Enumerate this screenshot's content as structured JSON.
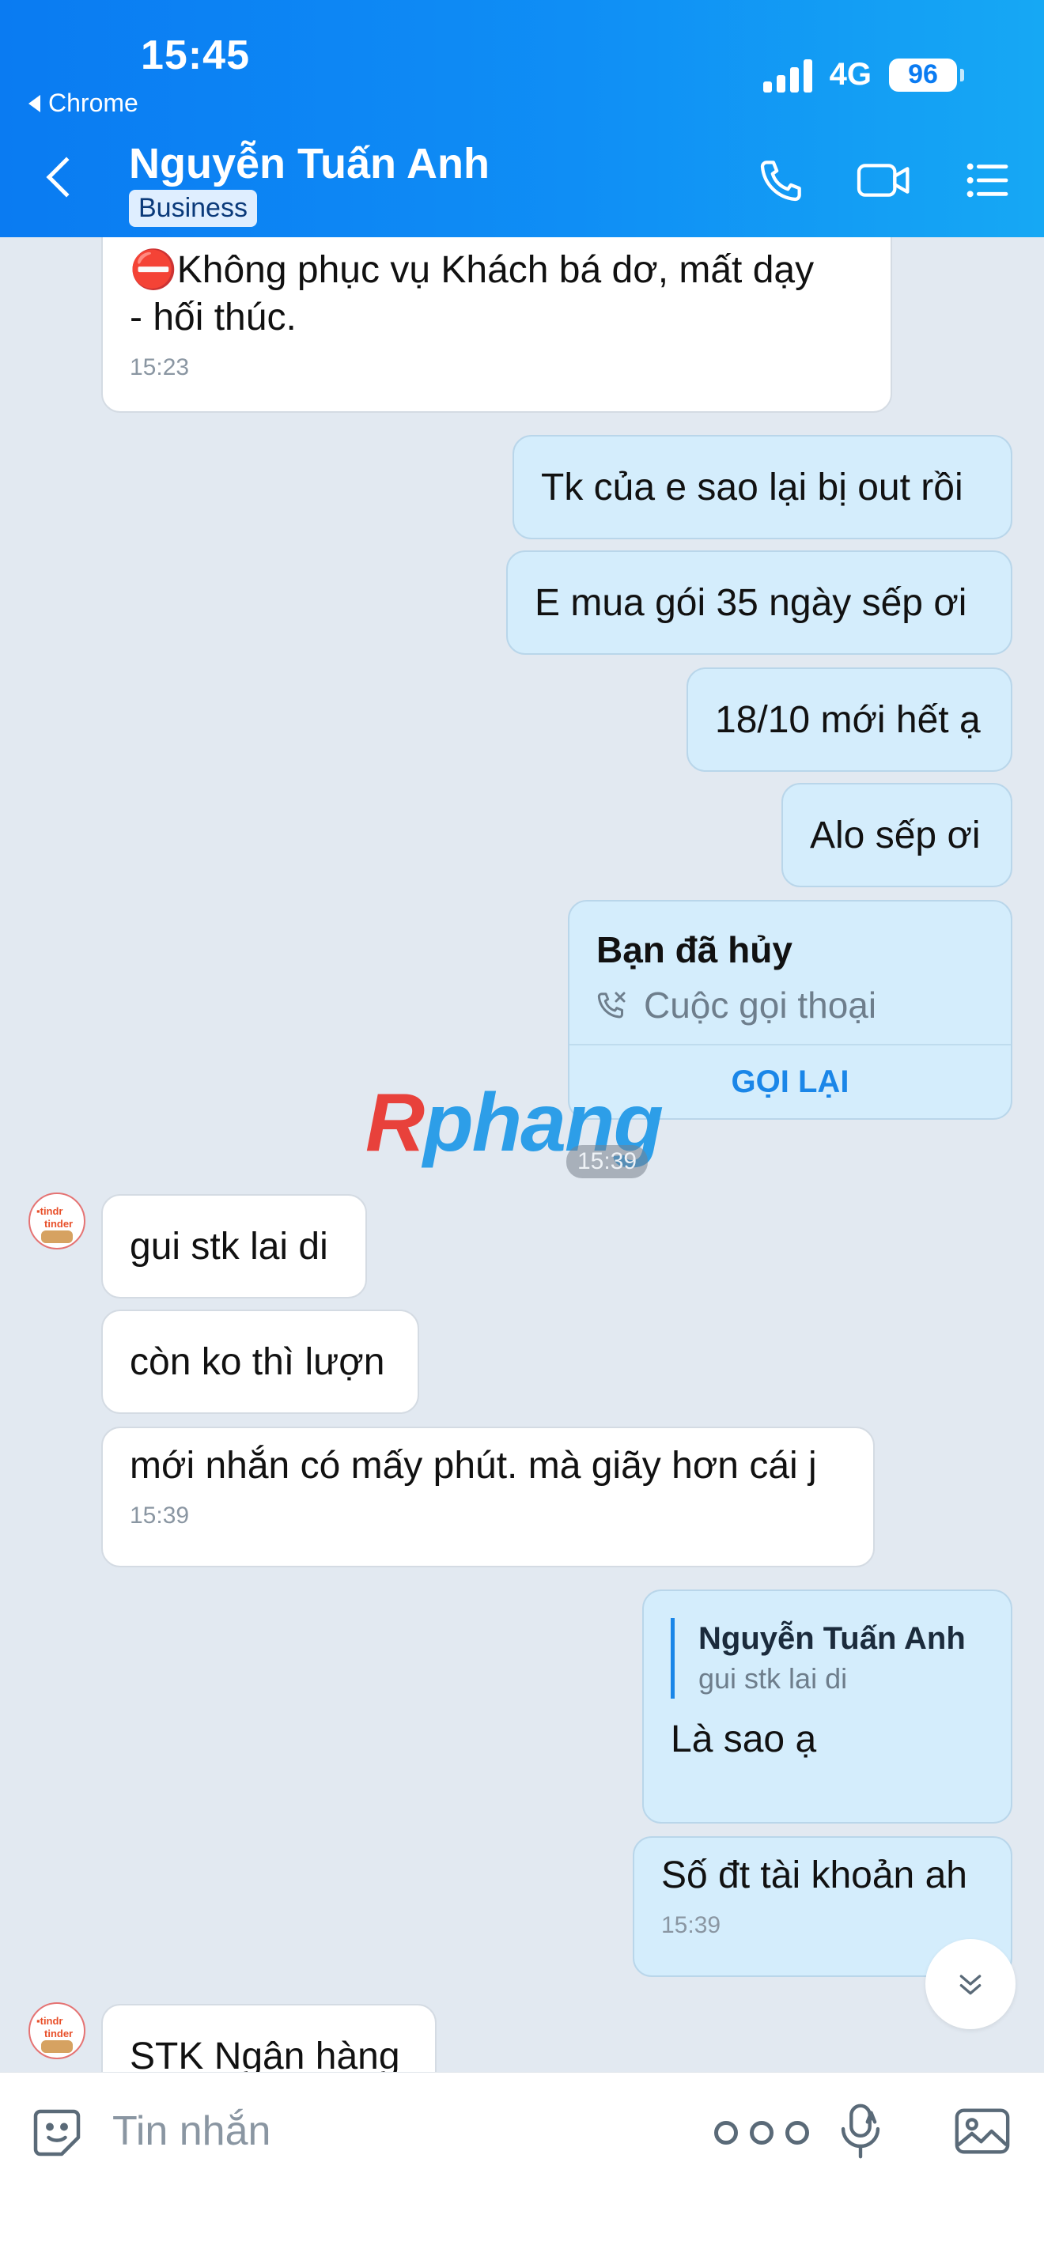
{
  "status_bar": {
    "time": "15:45",
    "back_app": "Chrome",
    "network": "4G",
    "battery": "96"
  },
  "header": {
    "contact_name": "Nguyễn Tuấn Anh",
    "badge": "Business",
    "icons": [
      "phone-icon",
      "video-call-icon",
      "menu-list-icon"
    ]
  },
  "messages": {
    "m1_line1": "⛔Không phục vụ Khách bá dơ, mất dạy",
    "m1_line2": "- hối thúc.",
    "m1_time": "15:23",
    "m2": "Tk của e sao lại bị out rồi",
    "m3": "E mua gói 35 ngày sếp ơi",
    "m4": "18/10 mới hết ạ",
    "m5": "Alo sếp ơi",
    "call_title": "Bạn đã hủy",
    "call_subtitle": "Cuộc gọi thoại",
    "call_button": "GỌI LẠI",
    "divider_time": "15:39",
    "m6": "gui stk lai di",
    "m7": "còn ko thì lượn",
    "m8": "mới nhắn có mấy phút. mà giãy hơn cái j",
    "m8_time": "15:39",
    "reply_quote_name": "Nguyễn Tuấn Anh",
    "reply_quote_text": "gui stk lai di",
    "m9": "Là sao ạ",
    "m10": "Số đt tài khoản ah",
    "m10_time": "15:39",
    "m11": "STK Ngân hàng"
  },
  "watermark": {
    "part1": "R",
    "part2": "phang"
  },
  "input_bar": {
    "placeholder": "Tin nhắn"
  },
  "colors": {
    "header_blue": "#0a7bf2",
    "outgoing_bubble": "#d4edfc",
    "incoming_bubble": "#ffffff",
    "chat_background": "#e2e9f1",
    "accent": "#1a86e8"
  }
}
